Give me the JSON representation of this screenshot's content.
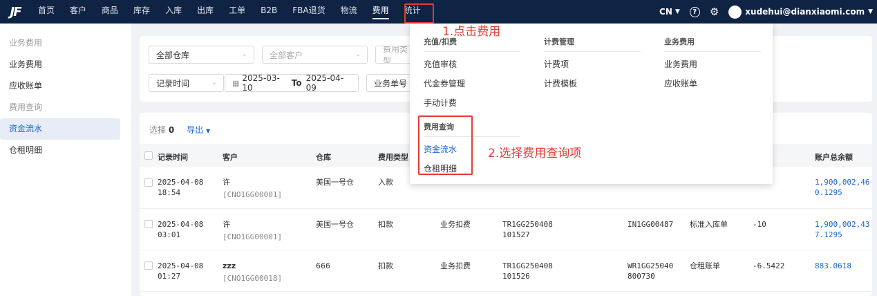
{
  "nav": {
    "logo": "JF",
    "items": [
      "首页",
      "客户",
      "商品",
      "库存",
      "入库",
      "出库",
      "工单",
      "B2B",
      "FBA退货",
      "物流",
      "费用",
      "统计"
    ],
    "active": "费用",
    "lang": "CN",
    "help_glyph": "?",
    "settings_glyph": "⚙",
    "user": "xudehui@dianxiaomi.com"
  },
  "annotations": {
    "step1": "1.点击费用",
    "step2": "2.选择费用查询项",
    "color": "#e53935"
  },
  "sidebar": {
    "group1": "业务费用",
    "item1": "业务费用",
    "item2": "应收账单",
    "group2": "费用查询",
    "item3": "资金流水",
    "item4": "仓租明细"
  },
  "filters": {
    "warehouse": "全部仓库",
    "customer_placeholder": "全部客户",
    "fee_type_placeholder": "费用类型",
    "time_type": "记录时间",
    "date_from": "2025-03-10",
    "date_to_label": "To",
    "date_to": "2025-04-09",
    "order_no": "业务单号"
  },
  "toolbar": {
    "selected_label": "选择",
    "selected_count": "0",
    "export": "导出"
  },
  "table": {
    "headers": {
      "time": "记录时间",
      "customer": "客户",
      "warehouse": "仓库",
      "fee_type": "费用类型",
      "balance": "账户总余额"
    },
    "rows": [
      {
        "date": "2025-04-08",
        "time": "18:54",
        "customer": "许",
        "customer_code": "[CNO1GG00001]",
        "warehouse": "美国一号仓",
        "fee_type": "入款",
        "fee_item": "",
        "order_a1": "",
        "order_a2": "",
        "order_b1": "",
        "doc_type": "",
        "amount": "",
        "balance1": "1,900,002,46",
        "balance2": "0.1295"
      },
      {
        "date": "2025-04-08",
        "time": "03:01",
        "customer": "许",
        "customer_code": "[CNO1GG00001]",
        "warehouse": "美国一号仓",
        "fee_type": "扣款",
        "fee_item": "业务扣费",
        "order_a1": "TR1GG250408",
        "order_a2": "101527",
        "order_b1": "IN1GG00487",
        "order_b2": "",
        "doc_type": "标准入库单",
        "amount": "-10",
        "balance1": "1,900,002,43",
        "balance2": "7.1295"
      },
      {
        "date": "2025-04-08",
        "time": "01:27",
        "customer": "zzz",
        "customer_code": "[CNO1GG00018]",
        "warehouse": "666",
        "fee_type": "扣款",
        "fee_item": "业务扣费",
        "order_a1": "TR1GG250408",
        "order_a2": "101526",
        "order_b1": "WR1GG25040",
        "order_b2": "800730",
        "doc_type": "仓租账单",
        "amount": "-6.5422",
        "balance1": "883.0618",
        "balance2": ""
      }
    ]
  },
  "dropdown": {
    "col1_head": "充值/扣费",
    "col1_items": [
      "充值审核",
      "代金券管理",
      "手动计费"
    ],
    "col2_head": "计费管理",
    "col2_items": [
      "计费项",
      "计费模板"
    ],
    "col3_head": "业务费用",
    "col3_items": [
      "业务费用",
      "应收账单"
    ],
    "col4_head": "费用查询",
    "col4_items": [
      "资金流水",
      "仓租明细"
    ]
  }
}
